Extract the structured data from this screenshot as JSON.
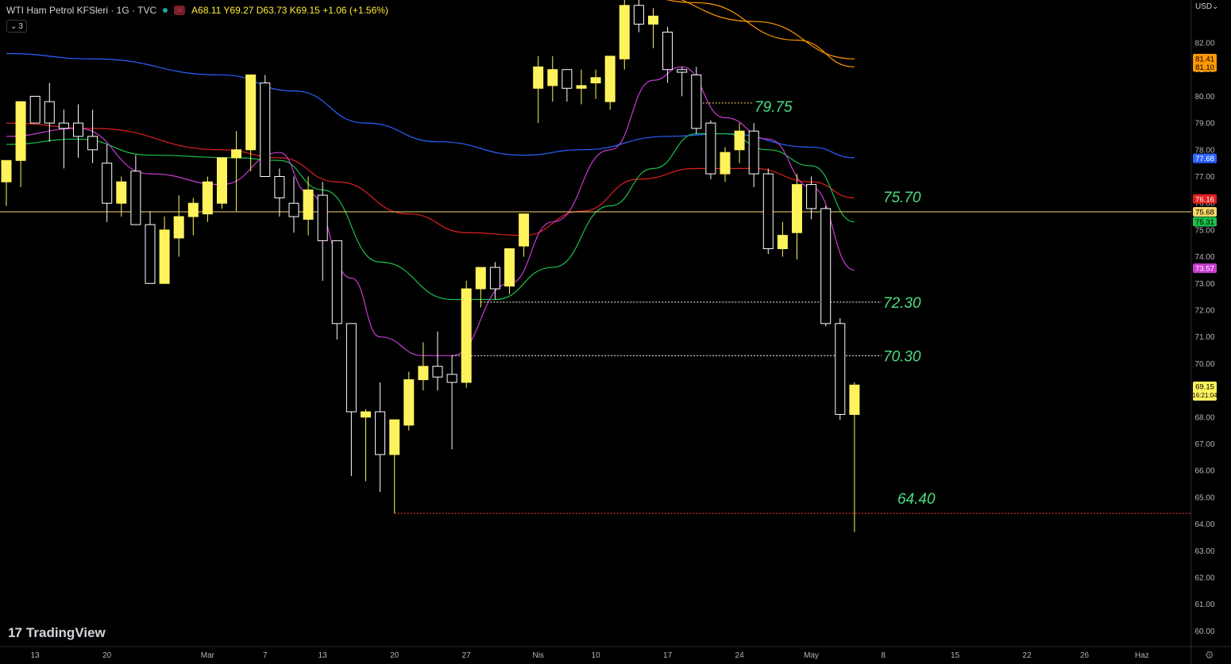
{
  "header": {
    "symbol": "WTI Ham Petrol KFSleri · 1G · TVC",
    "ohlc": "A68.11 Y69.27 D63.73 K69.15",
    "change": "+1.06 (+1.56%)",
    "indicators_count": "3"
  },
  "watermark": "TradingView",
  "currency": "USD",
  "colors": {
    "bull": "#fff35c",
    "bear": "#ffffff",
    "wick_bull": "#fff35c",
    "wick_bear": "#ffffff",
    "axis_text": "#b2b5be",
    "ma_orange": "#ff9800",
    "ma_blue": "#2962ff",
    "ma_red": "#e01f1f",
    "ma_green": "#1bbf4c",
    "ma_magenta": "#c83cd2",
    "level_text": "#4ade80"
  },
  "chart_data": {
    "type": "candlestick",
    "title": "WTI Ham Petrol KFSleri · 1G · TVC",
    "ylim": [
      59.5,
      84
    ],
    "y_ticks": [
      60,
      61,
      62,
      63,
      64,
      65,
      66,
      67,
      68,
      69,
      70,
      71,
      72,
      73,
      74,
      75,
      76,
      77,
      78,
      79,
      80,
      81,
      82
    ],
    "x_tick_labels": [
      {
        "label": "13",
        "i": 2
      },
      {
        "label": "20",
        "i": 7
      },
      {
        "label": "Mar",
        "i": 14
      },
      {
        "label": "7",
        "i": 18
      },
      {
        "label": "13",
        "i": 22
      },
      {
        "label": "20",
        "i": 27
      },
      {
        "label": "27",
        "i": 32
      },
      {
        "label": "Nis",
        "i": 37
      },
      {
        "label": "10",
        "i": 41
      },
      {
        "label": "17",
        "i": 46
      },
      {
        "label": "24",
        "i": 51
      },
      {
        "label": "May",
        "i": 56
      },
      {
        "label": "8",
        "i": 61
      },
      {
        "label": "15",
        "i": 66
      },
      {
        "label": "22",
        "i": 71
      },
      {
        "label": "26",
        "i": 75
      },
      {
        "label": "Haz",
        "i": 79
      }
    ],
    "candles": [
      {
        "o": 76.8,
        "h": 77.3,
        "l": 75.9,
        "c": 77.6
      },
      {
        "o": 77.6,
        "h": 78.7,
        "l": 76.6,
        "c": 79.8
      },
      {
        "o": 80.0,
        "h": 79.5,
        "l": 79.5,
        "c": 79.0
      },
      {
        "o": 79.8,
        "h": 80.5,
        "l": 78.3,
        "c": 79.0
      },
      {
        "o": 79.0,
        "h": 79.5,
        "l": 77.3,
        "c": 78.8
      },
      {
        "o": 79.0,
        "h": 79.7,
        "l": 77.7,
        "c": 78.5
      },
      {
        "o": 78.5,
        "h": 79.5,
        "l": 77.5,
        "c": 78.0
      },
      {
        "o": 77.5,
        "h": 78.2,
        "l": 75.3,
        "c": 76.0
      },
      {
        "o": 76.0,
        "h": 77.0,
        "l": 75.5,
        "c": 76.8
      },
      {
        "o": 77.2,
        "h": 77.8,
        "l": 75.5,
        "c": 75.2
      },
      {
        "o": 75.2,
        "h": 75.7,
        "l": 73.8,
        "c": 73.0
      },
      {
        "o": 73.0,
        "h": 75.5,
        "l": 73.8,
        "c": 75.0
      },
      {
        "o": 74.7,
        "h": 76.3,
        "l": 74.0,
        "c": 75.5
      },
      {
        "o": 75.5,
        "h": 76.2,
        "l": 74.8,
        "c": 76.0
      },
      {
        "o": 75.6,
        "h": 77.0,
        "l": 75.3,
        "c": 76.8
      },
      {
        "o": 76.0,
        "h": 77.6,
        "l": 75.8,
        "c": 77.7
      },
      {
        "o": 77.7,
        "h": 78.7,
        "l": 75.7,
        "c": 78.0
      },
      {
        "o": 78.0,
        "h": 80.2,
        "l": 77.2,
        "c": 80.8
      },
      {
        "o": 80.5,
        "h": 80.8,
        "l": 78.0,
        "c": 77.0
      },
      {
        "o": 77.0,
        "h": 77.3,
        "l": 75.5,
        "c": 76.2
      },
      {
        "o": 76.0,
        "h": 77.0,
        "l": 74.9,
        "c": 75.5
      },
      {
        "o": 75.4,
        "h": 77.0,
        "l": 74.8,
        "c": 76.5
      },
      {
        "o": 76.3,
        "h": 76.8,
        "l": 73.1,
        "c": 74.6
      },
      {
        "o": 74.6,
        "h": 74.5,
        "l": 70.9,
        "c": 71.5
      },
      {
        "o": 71.5,
        "h": 71.0,
        "l": 65.8,
        "c": 68.2
      },
      {
        "o": 68.0,
        "h": 68.3,
        "l": 65.6,
        "c": 68.2
      },
      {
        "o": 68.2,
        "h": 69.3,
        "l": 65.2,
        "c": 66.6
      },
      {
        "o": 66.6,
        "h": 67.3,
        "l": 64.4,
        "c": 67.9
      },
      {
        "o": 67.7,
        "h": 69.7,
        "l": 67.5,
        "c": 69.4
      },
      {
        "o": 69.4,
        "h": 70.8,
        "l": 69.0,
        "c": 69.9
      },
      {
        "o": 69.9,
        "h": 71.2,
        "l": 69.0,
        "c": 69.5
      },
      {
        "o": 69.6,
        "h": 70.3,
        "l": 66.8,
        "c": 69.3
      },
      {
        "o": 69.3,
        "h": 73.1,
        "l": 69.1,
        "c": 72.8
      },
      {
        "o": 72.8,
        "h": 73.5,
        "l": 72.1,
        "c": 73.6
      },
      {
        "o": 73.6,
        "h": 73.8,
        "l": 72.4,
        "c": 72.8
      },
      {
        "o": 72.9,
        "h": 74.0,
        "l": 72.6,
        "c": 74.3
      },
      {
        "o": 74.4,
        "h": 75.5,
        "l": 74.0,
        "c": 75.6
      },
      {
        "o": 80.3,
        "h": 81.5,
        "l": 79.0,
        "c": 81.1
      },
      {
        "o": 80.4,
        "h": 81.5,
        "l": 79.8,
        "c": 81.0
      },
      {
        "o": 81.0,
        "h": 80.7,
        "l": 79.8,
        "c": 80.3
      },
      {
        "o": 80.3,
        "h": 81.0,
        "l": 79.7,
        "c": 80.4
      },
      {
        "o": 80.5,
        "h": 81.0,
        "l": 79.9,
        "c": 80.7
      },
      {
        "o": 79.8,
        "h": 81.3,
        "l": 79.5,
        "c": 81.5
      },
      {
        "o": 81.4,
        "h": 83.8,
        "l": 81.0,
        "c": 83.4
      },
      {
        "o": 83.4,
        "h": 83.7,
        "l": 82.4,
        "c": 82.7
      },
      {
        "o": 82.7,
        "h": 83.3,
        "l": 81.8,
        "c": 83.0
      },
      {
        "o": 82.4,
        "h": 82.6,
        "l": 80.5,
        "c": 81.0
      },
      {
        "o": 81.0,
        "h": 81.1,
        "l": 80.0,
        "c": 80.9
      },
      {
        "o": 80.8,
        "h": 81.1,
        "l": 78.6,
        "c": 78.8
      },
      {
        "o": 79.0,
        "h": 79.1,
        "l": 76.9,
        "c": 77.1
      },
      {
        "o": 77.1,
        "h": 78.1,
        "l": 76.8,
        "c": 77.9
      },
      {
        "o": 78.0,
        "h": 79.0,
        "l": 77.5,
        "c": 78.7
      },
      {
        "o": 78.7,
        "h": 79.0,
        "l": 76.6,
        "c": 77.1
      },
      {
        "o": 77.1,
        "h": 77.3,
        "l": 74.1,
        "c": 74.3
      },
      {
        "o": 74.3,
        "h": 75.3,
        "l": 74.0,
        "c": 74.8
      },
      {
        "o": 74.9,
        "h": 77.1,
        "l": 73.9,
        "c": 76.7
      },
      {
        "o": 76.7,
        "h": 77.0,
        "l": 75.4,
        "c": 75.8
      },
      {
        "o": 75.8,
        "h": 75.9,
        "l": 71.4,
        "c": 71.5
      },
      {
        "o": 71.5,
        "h": 71.7,
        "l": 67.9,
        "c": 68.1
      },
      {
        "o": 68.1,
        "h": 69.3,
        "l": 63.7,
        "c": 69.2
      }
    ],
    "moving_averages": [
      {
        "color": "#ff9800",
        "values": {
          "36": 84.5,
          "44": 83.9,
          "52": 82.8,
          "59": 81.4
        }
      },
      {
        "color": "#ff9800",
        "values": {
          "40": 84.5,
          "48": 83.5,
          "55": 82.1,
          "59": 81.1
        }
      },
      {
        "color": "#2962ff",
        "values": {
          "0": 81.6,
          "6": 81.4,
          "15": 80.8,
          "20": 80.2,
          "25": 79.0,
          "30": 78.3,
          "36": 77.8,
          "40": 78.0,
          "46": 78.5,
          "50": 78.6,
          "56": 78.1,
          "59": 77.7
        }
      },
      {
        "color": "#e01f1f",
        "values": {
          "0": 79.0,
          "6": 78.8,
          "15": 78.0,
          "19": 77.7,
          "23": 76.8,
          "28": 75.6,
          "32": 74.9,
          "36": 74.8,
          "40": 75.7,
          "44": 76.9,
          "48": 77.3,
          "52": 77.3,
          "56": 76.8,
          "59": 76.2
        }
      },
      {
        "color": "#1bbf4c",
        "values": {
          "0": 78.2,
          "5": 78.4,
          "10": 77.8,
          "16": 77.7,
          "19": 77.6,
          "22": 76.5,
          "26": 73.8,
          "31": 72.4,
          "34": 72.4,
          "38": 73.6,
          "42": 75.9,
          "45": 77.3,
          "48": 78.6,
          "50": 78.6,
          "53": 78.0,
          "56": 77.4,
          "59": 75.3
        }
      },
      {
        "color": "#c83cd2",
        "values": {
          "0": 78.5,
          "5": 78.8,
          "10": 77.1,
          "15": 76.7,
          "19": 77.9,
          "21": 76.4,
          "24": 73.2,
          "26": 71.0,
          "29": 70.3,
          "31": 70.3,
          "35": 73.0,
          "38": 75.3,
          "42": 78.0,
          "45": 80.6,
          "47": 81.1,
          "50": 79.2,
          "53": 78.4,
          "56": 76.6,
          "59": 73.5
        }
      }
    ],
    "levels": [
      {
        "value": 75.68,
        "style": "solid",
        "color": "#f7d66b",
        "from_i": 0,
        "label": "75.70"
      },
      {
        "value": 72.3,
        "style": "dotted",
        "color": "#ffffff",
        "from_i": 33,
        "label": "72.30"
      },
      {
        "value": 70.3,
        "style": "dotted",
        "color": "#ffffff",
        "from_i": 31,
        "label": "70.30"
      },
      {
        "value": 64.4,
        "style": "dotted",
        "color": "#ff3b3b",
        "from_i": 27,
        "label": "64.40"
      },
      {
        "value": 79.75,
        "style": "dotted",
        "color": "#f7d66b",
        "from_i": 48,
        "to_i": 52,
        "label": "79.75"
      }
    ],
    "price_labels": [
      {
        "value": 81.41,
        "text": "81.41",
        "bg": "#ff9800",
        "fg": "#000000"
      },
      {
        "value": 81.1,
        "text": "81.10",
        "bg": "#ff9800",
        "fg": "#000000"
      },
      {
        "value": 77.68,
        "text": "77.68",
        "bg": "#2962ff",
        "fg": "#ffffff"
      },
      {
        "value": 76.16,
        "text": "76.16",
        "bg": "#e01f1f",
        "fg": "#ffffff"
      },
      {
        "value": 75.68,
        "text": "75.68",
        "bg": "#f7d66b",
        "fg": "#000000"
      },
      {
        "value": 75.31,
        "text": "75.31",
        "bg": "#1bbf4c",
        "fg": "#000000"
      },
      {
        "value": 73.57,
        "text": "73.57",
        "bg": "#c83cd2",
        "fg": "#ffffff"
      },
      {
        "value": 69.15,
        "text": "69.15",
        "sub": "16:21:04",
        "bg": "#fff35c",
        "fg": "#000000"
      }
    ]
  }
}
